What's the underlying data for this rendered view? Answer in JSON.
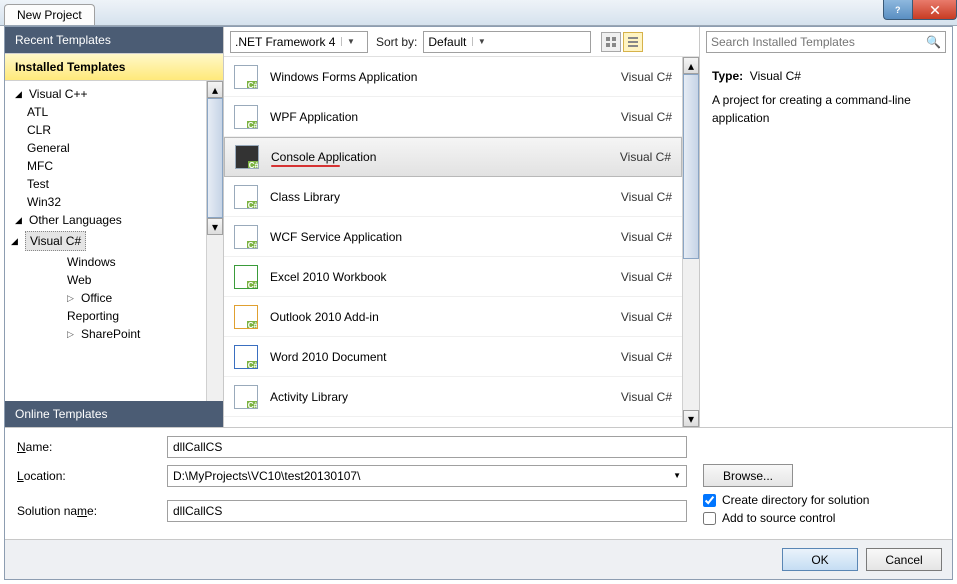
{
  "window": {
    "title": "New Project"
  },
  "left": {
    "recent_header": "Recent Templates",
    "installed_header": "Installed Templates",
    "online_header": "Online Templates",
    "tree": {
      "vcpp": "Visual C++",
      "atl": "ATL",
      "clr": "CLR",
      "general": "General",
      "mfc": "MFC",
      "test": "Test",
      "win32": "Win32",
      "other_lang": "Other Languages",
      "vcs": "Visual C#",
      "windows": "Windows",
      "web": "Web",
      "office": "Office",
      "reporting": "Reporting",
      "sharepoint": "SharePoint"
    }
  },
  "toolbar": {
    "framework": ".NET Framework 4",
    "sort_label": "Sort by:",
    "sort_value": "Default"
  },
  "templates": [
    {
      "name": "Windows Forms Application",
      "lang": "Visual C#"
    },
    {
      "name": "WPF Application",
      "lang": "Visual C#"
    },
    {
      "name": "Console Application",
      "lang": "Visual C#"
    },
    {
      "name": "Class Library",
      "lang": "Visual C#"
    },
    {
      "name": "WCF Service Application",
      "lang": "Visual C#"
    },
    {
      "name": "Excel 2010 Workbook",
      "lang": "Visual C#"
    },
    {
      "name": "Outlook 2010 Add-in",
      "lang": "Visual C#"
    },
    {
      "name": "Word 2010 Document",
      "lang": "Visual C#"
    },
    {
      "name": "Activity Library",
      "lang": "Visual C#"
    }
  ],
  "right": {
    "search_placeholder": "Search Installed Templates",
    "type_label": "Type:",
    "type_value": "Visual C#",
    "description": "A project for creating a command-line application"
  },
  "form": {
    "name_label": "Name:",
    "name_value": "dllCallCS",
    "location_label": "Location:",
    "location_value": "D:\\MyProjects\\VC10\\test20130107\\",
    "solution_label": "Solution name:",
    "solution_value": "dllCallCS",
    "browse": "Browse...",
    "create_dir": "Create directory for solution",
    "source_ctrl": "Add to source control"
  },
  "buttons": {
    "ok": "OK",
    "cancel": "Cancel"
  }
}
